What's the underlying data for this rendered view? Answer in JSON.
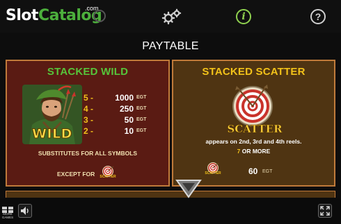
{
  "topbar": {
    "logo_slot": "Slot",
    "logo_catalog": "Catalog",
    "logo_com": ".com",
    "info_label": "i",
    "help_label": "?"
  },
  "page_title": "PAYTABLE",
  "stacked_wild": {
    "title": "STACKED WILD",
    "symbol_word": "WILD",
    "payouts": [
      {
        "count": "5",
        "dash": "-",
        "value": "1000",
        "unit": "EGT"
      },
      {
        "count": "4",
        "dash": "-",
        "value": "250",
        "unit": "EGT"
      },
      {
        "count": "3",
        "dash": "-",
        "value": "50",
        "unit": "EGT"
      },
      {
        "count": "2",
        "dash": "-",
        "value": "10",
        "unit": "EGT"
      }
    ],
    "substitutes_text": "SUBSTITUTES FOR ALL SYMBOLS",
    "except_text": "EXCEPT FOR",
    "except_symbol_label": "SCATTER"
  },
  "stacked_scatter": {
    "title": "STACKED SCATTER",
    "symbol_word": "SCATTER",
    "description": "appears on 2nd, 3rd and 4th reels.",
    "requirement_count": "7",
    "requirement_text": "OR MORE",
    "mini_label": "SCATTER",
    "payout_value": "60",
    "payout_unit": "EGT"
  },
  "bottombar": {
    "more_games_label": "MORE GAMES"
  },
  "colors": {
    "wild_title": "#56c43a",
    "scatter_title": "#f2c21a",
    "panel_border": "#c07a3a",
    "wild_panel_bg": "#5a1b13",
    "scatter_panel_bg": "#4f3412"
  }
}
